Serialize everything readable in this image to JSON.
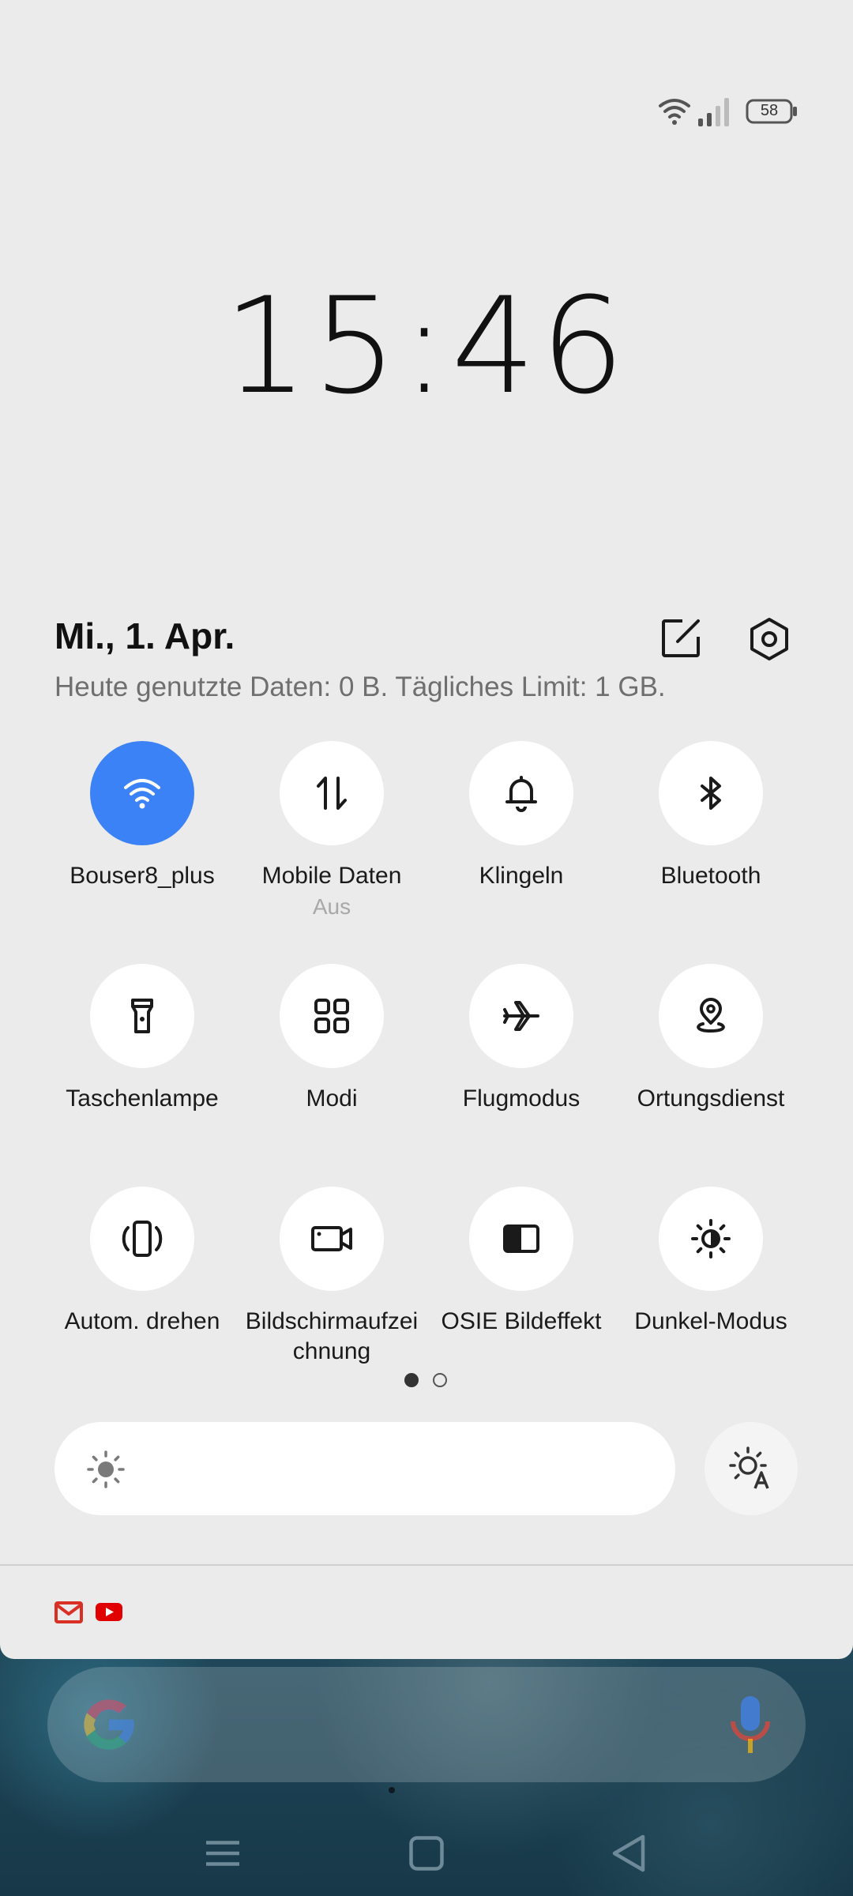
{
  "status_bar": {
    "battery_level": "58",
    "icons": [
      "wifi-icon",
      "signal-icon",
      "battery-icon"
    ]
  },
  "clock": {
    "time": "15:46"
  },
  "header": {
    "date": "Mi., 1. Apr.",
    "data_usage": "Heute genutzte Daten: 0 B. Tägliches Limit: 1 GB.",
    "icons": [
      "edit-icon",
      "settings-icon"
    ]
  },
  "tiles": [
    {
      "label": "Bouser8_plus",
      "icon": "wifi-icon",
      "active": true
    },
    {
      "label": "Mobile Daten",
      "sublabel": "Aus",
      "icon": "mobile-data-icon",
      "active": false
    },
    {
      "label": "Klingeln",
      "icon": "bell-icon",
      "active": false
    },
    {
      "label": "Bluetooth",
      "icon": "bluetooth-icon",
      "active": false
    },
    {
      "label": "Taschenlampe",
      "icon": "flashlight-icon",
      "active": false
    },
    {
      "label": "Modi",
      "icon": "grid-icon",
      "active": false
    },
    {
      "label": "Flugmodus",
      "icon": "airplane-icon",
      "active": false
    },
    {
      "label": "Ortungsdienst",
      "icon": "location-icon",
      "active": false
    },
    {
      "label": "Autom. drehen",
      "icon": "auto-rotate-icon",
      "active": false
    },
    {
      "label": "Bildschirmaufzei chnung",
      "icon": "screen-record-icon",
      "active": false
    },
    {
      "label": "OSIE Bildeffekt",
      "icon": "image-effect-icon",
      "active": false
    },
    {
      "label": "Dunkel-Modus",
      "icon": "dark-mode-icon",
      "active": false
    }
  ],
  "pager": {
    "pages": 2,
    "current": 1
  },
  "brightness": {
    "icons": [
      "sun-icon",
      "auto-brightness-icon"
    ]
  },
  "notifications": {
    "icons": [
      "gmail-icon",
      "youtube-icon"
    ]
  },
  "colors": {
    "accent": "#3b82f6",
    "shade_background": "#ebebeb",
    "gmail_red": "#d93025",
    "youtube_red": "#e00000"
  },
  "nav": {
    "icons": [
      "menu-icon",
      "home-icon",
      "back-icon"
    ]
  }
}
